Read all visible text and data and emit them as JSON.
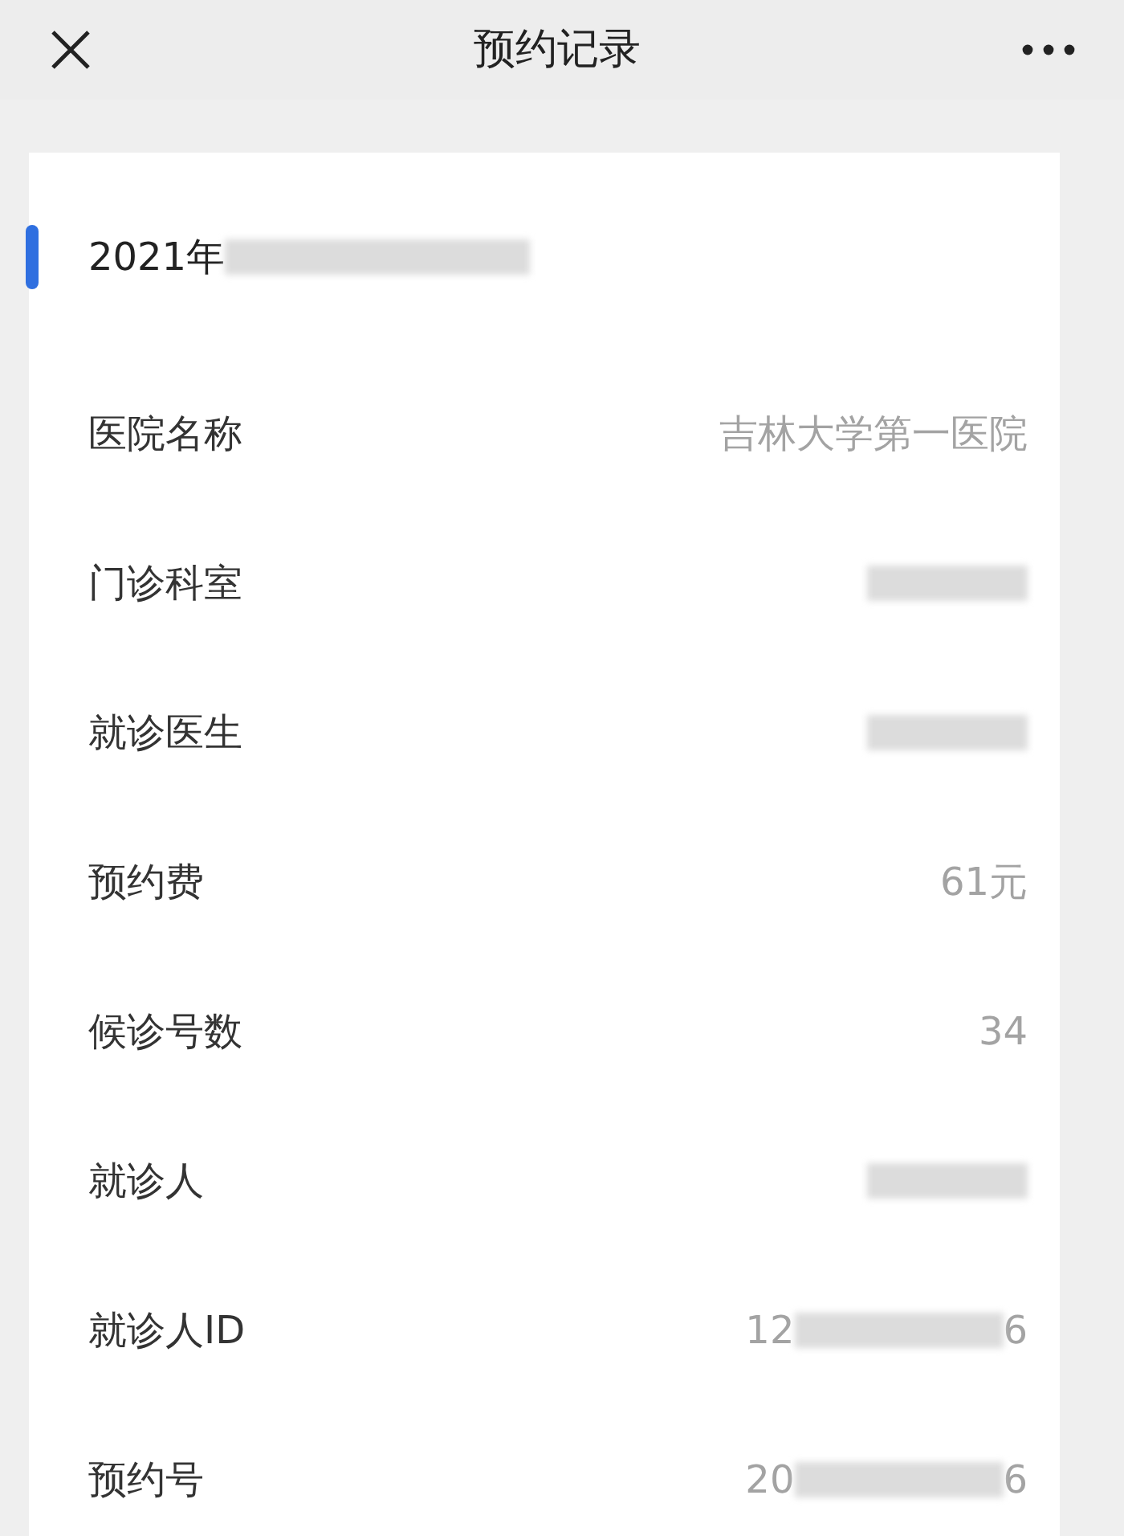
{
  "header": {
    "title": "预约记录"
  },
  "record": {
    "date_prefix": "2021年",
    "date_redacted": true,
    "fields": [
      {
        "label": "医院名称",
        "value": {
          "kind": "text",
          "text": "吉林大学第一医院"
        }
      },
      {
        "label": "门诊科室",
        "value": {
          "kind": "redacted"
        }
      },
      {
        "label": "就诊医生",
        "value": {
          "kind": "redacted"
        }
      },
      {
        "label": "预约费",
        "value": {
          "kind": "text",
          "text": "61元"
        }
      },
      {
        "label": "候诊号数",
        "value": {
          "kind": "text",
          "text": "34"
        }
      },
      {
        "label": "就诊人",
        "value": {
          "kind": "redacted"
        }
      },
      {
        "label": "就诊人ID",
        "value": {
          "kind": "partial",
          "prefix": "12",
          "suffix": "6"
        }
      },
      {
        "label": "预约号",
        "value": {
          "kind": "partial",
          "prefix": "20",
          "suffix": "6"
        }
      }
    ]
  }
}
